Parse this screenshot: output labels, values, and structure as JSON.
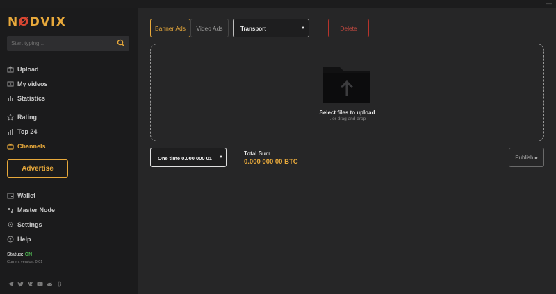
{
  "window": {
    "controls": "—"
  },
  "app": {
    "logo_pre": "N",
    "logo_o": "Ø",
    "logo_post": "DVIX"
  },
  "search": {
    "placeholder": "Start typing..."
  },
  "sidebar": {
    "items": [
      {
        "label": "Upload",
        "icon": "upload-icon"
      },
      {
        "label": "My videos",
        "icon": "video-icon"
      },
      {
        "label": "Statistics",
        "icon": "statistics-icon"
      },
      {
        "label": "Rating",
        "icon": "star-icon"
      },
      {
        "label": "Top 24",
        "icon": "bar-chart-icon"
      },
      {
        "label": "Channels",
        "icon": "channels-icon",
        "active": true
      },
      {
        "label": "Wallet",
        "icon": "wallet-icon"
      },
      {
        "label": "Master Node",
        "icon": "master-node-icon"
      },
      {
        "label": "Settings",
        "icon": "gear-icon"
      },
      {
        "label": "Help",
        "icon": "help-icon"
      }
    ],
    "advertise_label": "Advertise",
    "status_label": "Status:",
    "status_value": "ON",
    "version": "Current version: 0.01",
    "socials": [
      "telegram-icon",
      "twitter-icon",
      "vk-icon",
      "youtube-icon",
      "reddit-icon",
      "bitcoin-icon"
    ]
  },
  "toolbar": {
    "tabs": [
      "Banner Ads",
      "Video Ads"
    ],
    "active_tab": "Banner Ads",
    "category": "Transport",
    "caret": "▼",
    "delete_label": "Delete"
  },
  "dropzone": {
    "title": "Select files to upload",
    "subtitle": "...or drag and drop",
    "icon": "folder-upload-icon"
  },
  "footer": {
    "amount": "One time 0.000 000 01",
    "total_label": "Total Sum",
    "total_value": "0.000 000 00 BTC",
    "publish_label": "Publish ▸"
  },
  "colors": {
    "accent": "#e8a93b",
    "danger": "#c84a40",
    "status_on": "#4caf50",
    "background": "#262627",
    "sidebar": "#1b1b1c"
  }
}
